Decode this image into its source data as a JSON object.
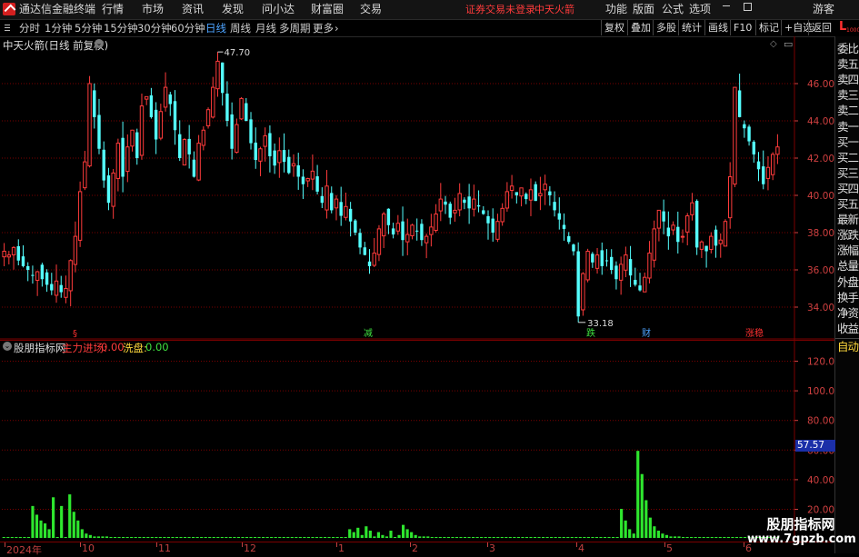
{
  "menubar": {
    "app_title": "通达信金融终端",
    "items": [
      "行情",
      "市场",
      "资讯",
      "发现",
      "问小达",
      "财富圈",
      "交易"
    ],
    "warning": "证券交易未登录",
    "stock": "中天火箭",
    "right_items": [
      "功能",
      "版面",
      "公式",
      "选项"
    ],
    "guest": "游客"
  },
  "periods": {
    "items": [
      "分时",
      "1分钟",
      "5分钟",
      "15分钟",
      "30分钟",
      "60分钟",
      "日线",
      "周线",
      "月线",
      "多周期",
      "更多"
    ],
    "active": "日线",
    "right_buttons": [
      "复权",
      "叠加",
      "多股",
      "统计",
      "画线",
      "F10",
      "标记",
      "+自选",
      "返回"
    ]
  },
  "sidebar": {
    "top_tag": "L",
    "top_tag_num": "1000",
    "items": [
      "委比",
      "卖五",
      "卖四",
      "卖三",
      "卖二",
      "卖一",
      "买一",
      "买二",
      "买三",
      "买四",
      "买五",
      "最新",
      "涨跌",
      "涨幅",
      "总量",
      "外盘",
      "换手",
      "净资",
      "收益"
    ],
    "auto": "自动"
  },
  "main_chart": {
    "title": "中天火箭(日线 前复权)",
    "high_label": "47.70",
    "low_label": "33.18",
    "markers": [
      {
        "text": "§",
        "color": "#ff3030",
        "x": 80
      },
      {
        "text": "减",
        "color": "#3fe03f",
        "x": 400
      },
      {
        "text": "跌",
        "color": "#3fe03f",
        "x": 645
      },
      {
        "text": "财",
        "color": "#4da3ff",
        "x": 706
      },
      {
        "text": "涨稳",
        "color": "#ff3030",
        "x": 820
      }
    ]
  },
  "indicator": {
    "name": "股朋指标网",
    "line1_label": "主力进场:",
    "line1_value": "0.00",
    "line2_label": "洗盘:",
    "line2_value": "0.00",
    "current_value": "57.57",
    "current_value_num": 57.57
  },
  "xaxis": {
    "labels": [
      {
        "text": "2024年",
        "x": 5
      },
      {
        "text": "10",
        "x": 88
      },
      {
        "text": "11",
        "x": 172
      },
      {
        "text": "12",
        "x": 266
      },
      {
        "text": "1",
        "x": 370
      },
      {
        "text": "2",
        "x": 451
      },
      {
        "text": "3",
        "x": 536
      },
      {
        "text": "4",
        "x": 634
      },
      {
        "text": "5",
        "x": 731
      },
      {
        "text": "6",
        "x": 818
      }
    ]
  },
  "watermark": {
    "line1": "股朋指标网",
    "line2": "www.7gpzb.com"
  },
  "colors": {
    "up": "#ff3b3b",
    "down": "#54ffff",
    "bar": "#2ee62e",
    "grid": "#7a0000",
    "axis": "#d04040",
    "active": "#4da3ff"
  },
  "chart_data": [
    {
      "type": "candlestick",
      "title": "中天火箭(日线 前复权)",
      "ylim": [
        33,
        49
      ],
      "yticks": [
        34.0,
        36.0,
        38.0,
        40.0,
        42.0,
        44.0,
        46.0
      ],
      "closes": [
        37.0,
        36.8,
        37.2,
        36.5,
        36.2,
        36.0,
        35.7,
        35.9,
        35.5,
        35.2,
        34.9,
        35.4,
        34.8,
        35.0,
        36.5,
        37.8,
        40.2,
        41.8,
        46.0,
        44.2,
        42.5,
        40.8,
        39.6,
        41.2,
        42.8,
        41.0,
        42.6,
        43.5,
        42.0,
        44.8,
        45.3,
        44.2,
        43.0,
        44.5,
        45.8,
        44.9,
        43.5,
        42.0,
        43.0,
        42.2,
        41.0,
        42.8,
        43.5,
        44.6,
        45.8,
        47.2,
        45.5,
        44.0,
        42.5,
        43.8,
        45.2,
        44.0,
        42.8,
        41.9,
        42.5,
        43.2,
        42.1,
        41.6,
        42.4,
        41.8,
        41.2,
        41.7,
        41.0,
        40.6,
        40.9,
        41.3,
        40.2,
        39.6,
        40.5,
        39.2,
        39.8,
        38.9,
        39.4,
        38.6,
        38.0,
        37.2,
        36.8,
        36.2,
        36.9,
        38.2,
        39.0,
        38.4,
        37.9,
        38.5,
        37.6,
        37.9,
        38.4,
        38.1,
        37.6,
        37.8,
        38.3,
        39.0,
        39.8,
        39.5,
        38.8,
        39.2,
        40.1,
        39.6,
        39.3,
        39.8,
        39.4,
        39.0,
        38.5,
        38.0,
        38.6,
        39.3,
        40.2,
        40.5,
        40.0,
        40.4,
        39.8,
        40.3,
        39.7,
        40.1,
        40.6,
        40.0,
        39.2,
        38.7,
        38.2,
        37.5,
        37.0,
        33.5,
        35.8,
        37.0,
        36.4,
        36.8,
        36.2,
        36.5,
        36.0,
        35.5,
        36.3,
        36.8,
        35.7,
        35.2,
        34.9,
        35.6,
        36.9,
        38.2,
        39.2,
        38.6,
        37.8,
        38.4,
        37.5,
        37.8,
        38.9,
        39.6,
        37.2,
        37.5,
        37.0,
        37.8,
        37.3,
        37.6,
        38.6,
        41.0,
        45.8,
        44.2,
        43.6,
        42.9,
        42.2,
        41.4,
        40.6,
        41.5,
        42.2,
        42.6
      ],
      "high": 47.7,
      "low": 33.18
    },
    {
      "type": "bar",
      "title": "股朋指标网",
      "ylim": [
        10,
        135
      ],
      "yticks": [
        20.0,
        40.0,
        60.0,
        80.0,
        100.0,
        120.0
      ],
      "series": [
        {
          "name": "主力进场",
          "values": [
            0,
            0,
            0,
            0,
            0,
            0,
            0,
            0,
            0,
            0,
            0,
            0,
            0,
            0,
            0,
            0,
            0,
            0,
            0,
            0,
            0,
            0,
            0,
            0,
            0,
            0,
            0,
            0,
            0,
            0,
            0,
            0,
            0,
            0,
            0,
            0,
            0,
            0,
            0,
            0,
            0,
            0,
            0,
            0,
            0,
            0,
            0,
            0,
            0,
            0,
            0,
            0,
            0,
            0,
            0,
            0,
            0,
            0,
            0,
            0,
            0,
            0,
            0,
            0,
            0,
            0,
            0,
            0,
            0,
            0,
            0,
            0,
            0,
            0,
            0,
            0,
            0,
            0,
            0,
            0,
            0,
            0,
            0,
            0,
            0,
            0,
            0,
            0,
            0,
            0,
            0,
            0,
            0,
            0,
            0,
            0,
            0,
            0,
            0,
            0,
            0,
            0,
            0,
            0,
            0,
            0,
            0,
            0,
            0,
            0,
            0,
            0,
            0,
            0,
            0,
            0,
            0,
            0,
            0,
            0,
            0,
            0,
            0,
            0,
            0,
            0,
            0,
            0,
            0,
            0,
            0,
            0,
            0,
            0,
            0,
            0,
            0,
            0,
            0,
            0,
            0,
            0,
            0,
            0,
            0,
            0,
            0,
            0,
            0,
            0,
            0,
            0,
            0,
            0,
            0,
            0,
            0,
            0,
            0,
            0,
            0,
            0,
            0,
            0,
            0,
            0,
            0,
            0,
            0
          ]
        },
        {
          "name": "洗盘",
          "values": [
            0,
            0,
            0,
            0,
            0,
            0,
            0,
            22,
            16,
            12,
            10,
            6,
            28,
            0,
            22,
            0,
            30,
            18,
            12,
            6,
            3,
            2,
            1,
            1,
            1,
            1,
            0,
            0,
            0,
            0,
            0,
            0,
            0,
            0,
            0,
            0,
            0,
            0,
            0,
            0,
            0,
            0,
            0,
            0,
            0,
            0,
            0,
            0,
            0,
            0,
            0,
            0,
            0,
            0,
            0,
            0,
            0,
            0,
            0,
            0,
            0,
            0,
            0,
            0,
            0,
            0,
            0,
            0,
            0,
            0,
            0,
            0,
            0,
            0,
            0,
            0,
            0,
            0,
            0,
            0,
            0,
            0,
            0,
            0,
            6,
            4,
            7,
            2,
            8,
            5,
            1,
            4,
            2,
            1,
            5,
            0,
            2,
            9,
            6,
            4,
            2,
            1,
            1,
            1,
            0,
            0,
            0,
            0,
            0,
            0,
            0,
            0,
            0,
            0,
            0,
            0,
            0,
            0,
            0,
            0,
            0,
            0,
            0,
            0,
            0,
            0,
            0,
            0,
            0,
            0,
            0,
            0,
            0,
            0,
            0,
            0,
            0,
            0,
            0,
            0,
            0,
            0,
            0,
            0,
            0,
            0,
            0,
            0,
            0,
            0,
            20,
            12,
            6,
            3,
            60,
            44,
            26,
            14,
            8,
            5,
            3,
            2,
            1,
            1,
            1,
            0,
            0,
            0,
            0,
            0,
            0,
            0,
            0,
            0,
            0,
            0,
            0,
            0,
            0,
            0,
            0,
            0,
            0,
            0,
            0,
            0,
            0,
            0,
            0
          ]
        }
      ],
      "current_value": 57.57
    }
  ]
}
